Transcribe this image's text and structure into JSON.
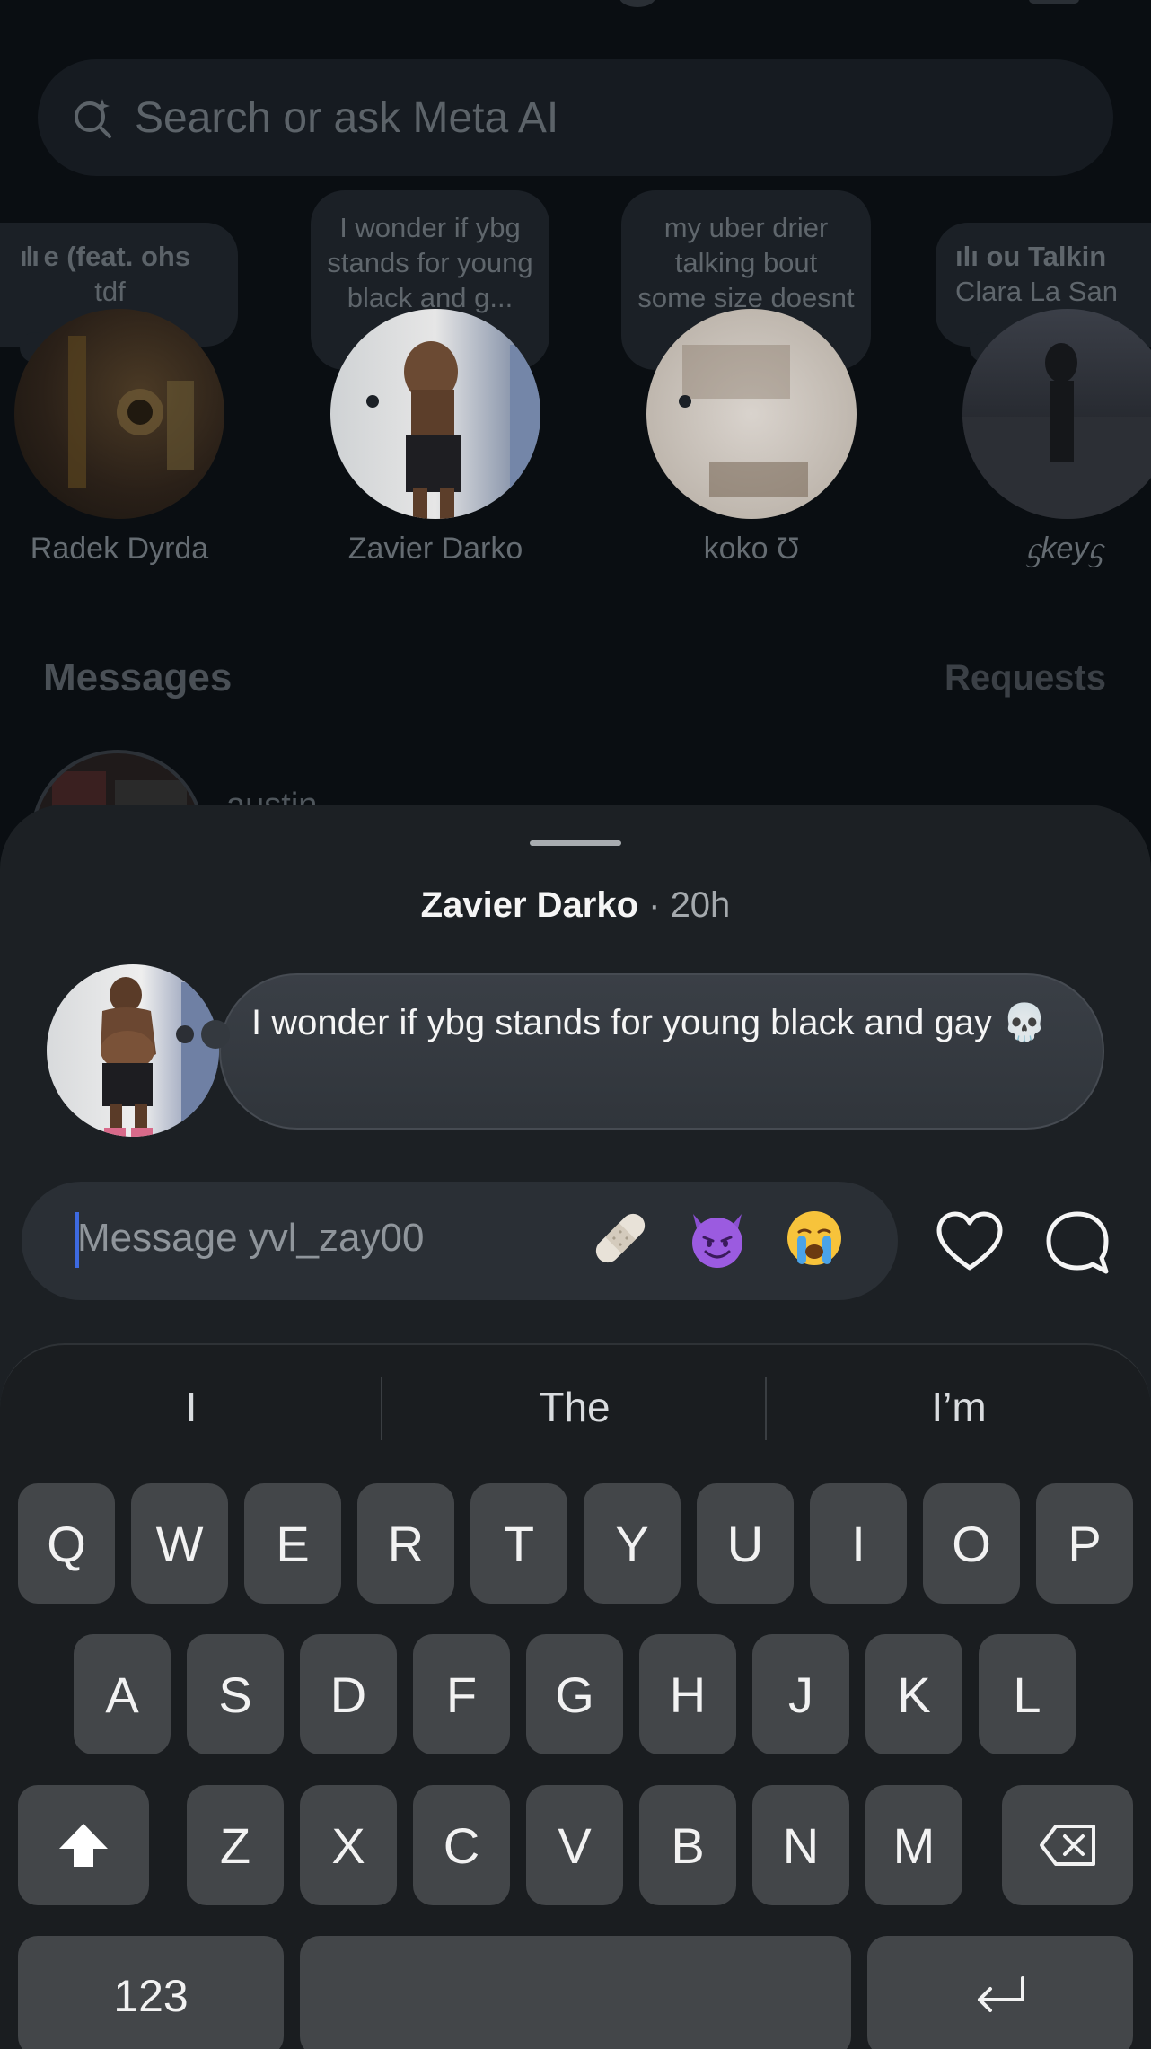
{
  "search": {
    "placeholder": "Search or ask Meta AI"
  },
  "stories": [
    {
      "name": "Radek Dyrda",
      "note": "e (feat. ohs\ntdf",
      "note_type": "music"
    },
    {
      "name": "Zavier Darko",
      "note": "I wonder if ybg stands for young black and g...",
      "note_type": "text"
    },
    {
      "name": "koko Ʊ",
      "note": "my uber drier talking bout some size doesnt matt...",
      "note_type": "text"
    },
    {
      "name": "ᦓkeyᦓ",
      "note": "ou  Talkin\nClara La San",
      "note_type": "music"
    }
  ],
  "messages_section": {
    "title": "Messages",
    "requests_label": "Requests"
  },
  "partial_row": {
    "name": "austin"
  },
  "sheet": {
    "author": "Zavier Darko",
    "time": " · 20h",
    "note_text": "I wonder if ybg stands for young black and gay 💀",
    "composer_placeholder": "Message yvl_zay00",
    "quick_emojis": [
      "🩹",
      "😈",
      "😭"
    ]
  },
  "keyboard": {
    "suggestions": [
      "I",
      "The",
      "I’m"
    ],
    "row1": [
      "Q",
      "W",
      "E",
      "R",
      "T",
      "Y",
      "U",
      "I",
      "O",
      "P"
    ],
    "row2": [
      "A",
      "S",
      "D",
      "F",
      "G",
      "H",
      "J",
      "K",
      "L"
    ],
    "row3": [
      "Z",
      "X",
      "C",
      "V",
      "B",
      "N",
      "M"
    ],
    "numbers_label": "123"
  },
  "colors": {
    "accent_caret": "#3d6ae0",
    "sheet_bg": "#1c2024",
    "key_bg": "#434649"
  }
}
